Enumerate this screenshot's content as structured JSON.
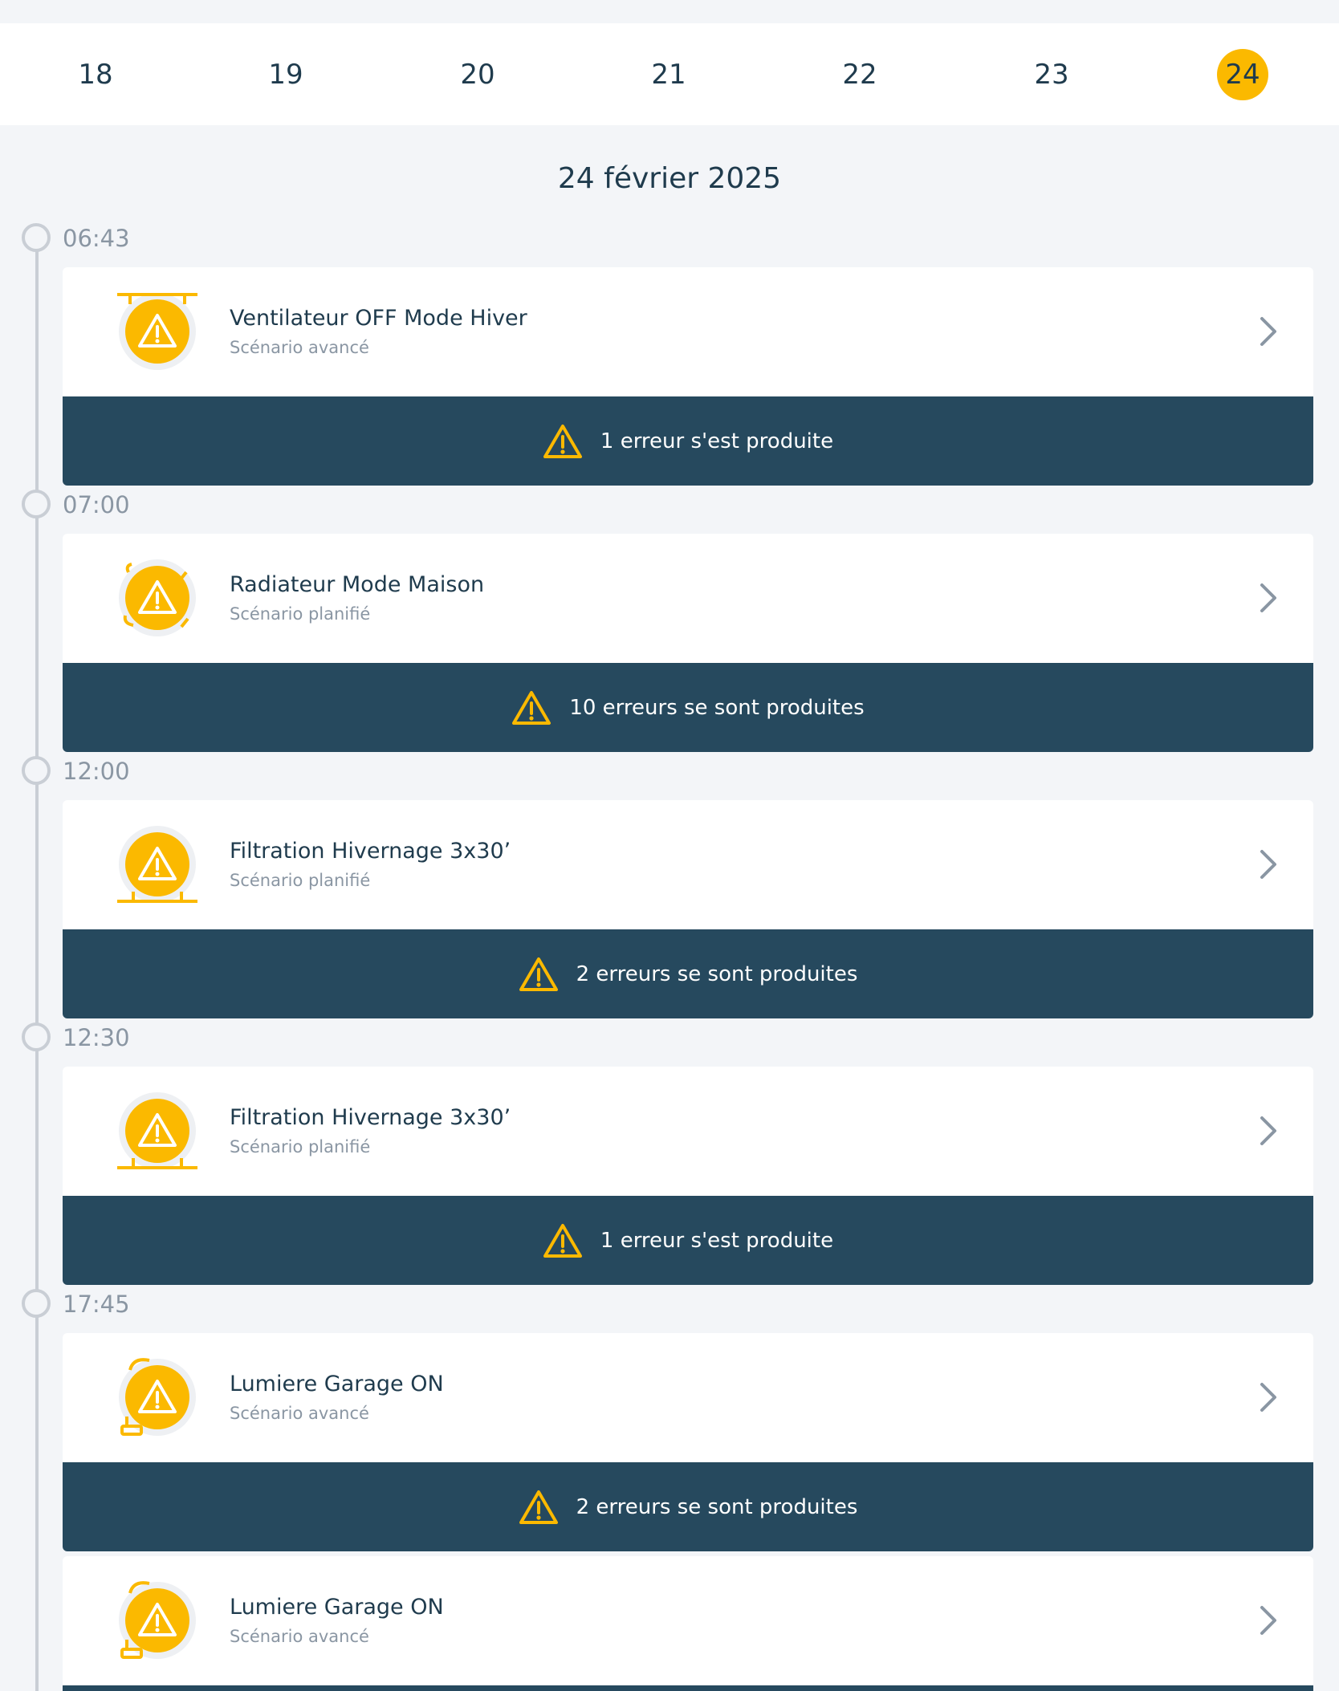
{
  "week": {
    "days": [
      "18",
      "19",
      "20",
      "21",
      "22",
      "23",
      "24"
    ],
    "selected_day": "24"
  },
  "date_heading": "24 février 2025",
  "colors": {
    "accent": "#fbb900",
    "error_bar": "#26495e",
    "text_primary": "#1f3b4d",
    "text_secondary": "#8a96a3",
    "timeline": "#c9ced5"
  },
  "entries": [
    {
      "time": "06:43",
      "title": "Ventilateur OFF Mode Hiver",
      "subtitle": "Scénario avancé",
      "icon": "fan-warning-icon",
      "error": "1 erreur s'est produite"
    },
    {
      "time": "07:00",
      "title": "Radiateur Mode Maison",
      "subtitle": "Scénario planifié",
      "icon": "radiator-warning-icon",
      "error": "10 erreurs se sont produites"
    },
    {
      "time": "12:00",
      "title": "Filtration Hivernage 3x30’",
      "subtitle": "Scénario planifié",
      "icon": "pool-filter-warning-icon",
      "error": "2 erreurs se sont produites"
    },
    {
      "time": "12:30",
      "title": "Filtration Hivernage 3x30’",
      "subtitle": "Scénario planifié",
      "icon": "pool-filter-warning-icon",
      "error": "1 erreur s'est produite"
    },
    {
      "time": "17:45",
      "title": "Lumiere Garage ON",
      "subtitle": "Scénario avancé",
      "icon": "light-warning-icon",
      "error": "2 erreurs se sont produites"
    },
    {
      "time": "",
      "title": "Lumiere Garage ON",
      "subtitle": "Scénario avancé",
      "icon": "light-warning-icon",
      "error": ""
    }
  ]
}
